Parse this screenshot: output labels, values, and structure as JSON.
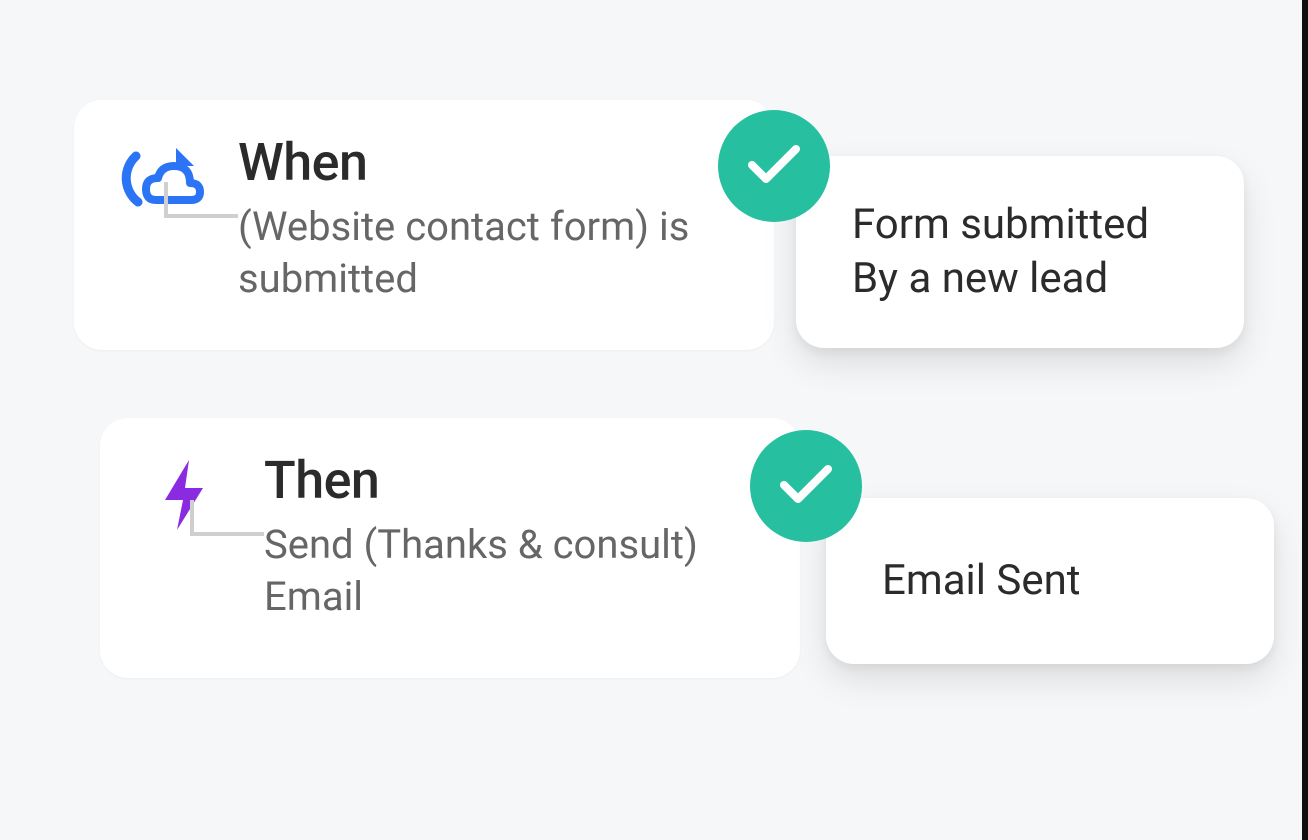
{
  "rules": [
    {
      "title": "When",
      "subtitle": "(Website contact form) is submitted",
      "icon": "cloud-reload-icon",
      "status": {
        "lines": [
          "Form submitted",
          "By a new lead"
        ],
        "check": true
      }
    },
    {
      "title": "Then",
      "subtitle": "Send (Thanks & consult) Email",
      "icon": "lightning-icon",
      "status": {
        "lines": [
          "Email Sent"
        ],
        "check": true
      }
    }
  ],
  "colors": {
    "badge": "#26bfa0",
    "icon_blue": "#2b74f5",
    "icon_purple": "#8a2be2"
  }
}
